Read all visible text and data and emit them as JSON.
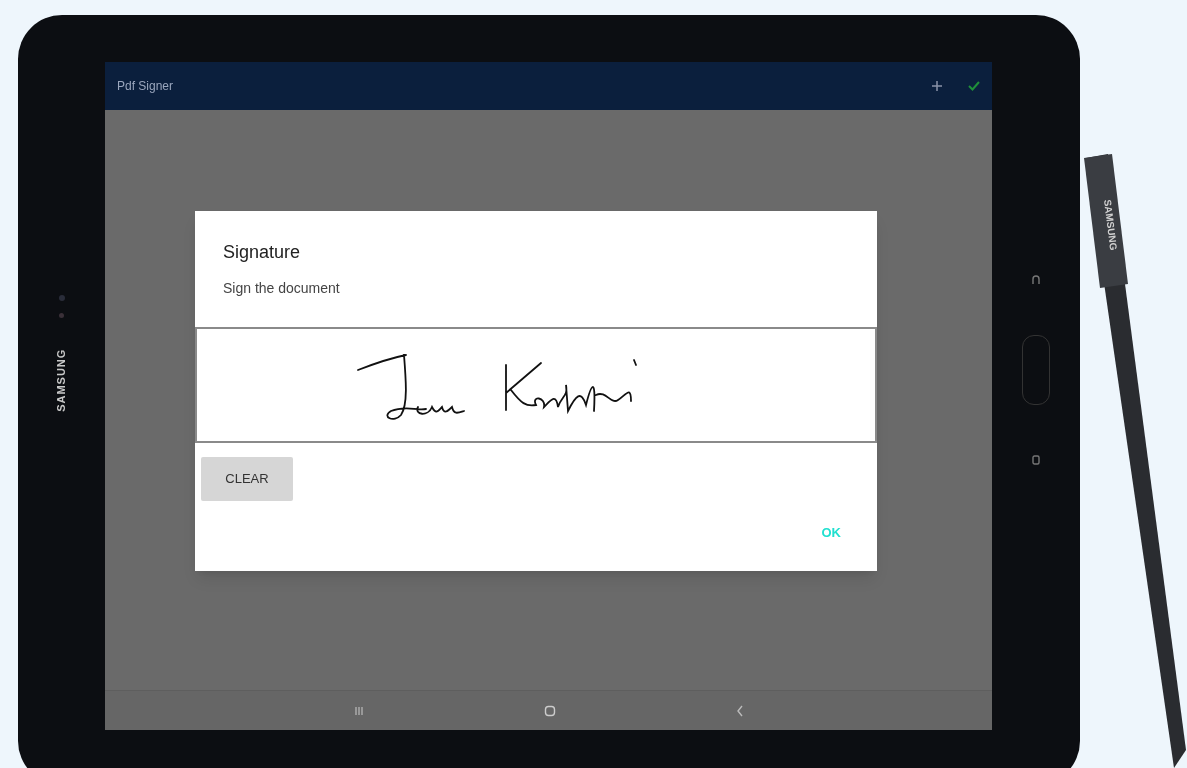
{
  "device": {
    "bezel_brand": "SAMSUNG",
    "stylus_brand": "SAMSUNG"
  },
  "app_bar": {
    "title": "Pdf Signer"
  },
  "dialog": {
    "title": "Signature",
    "subtitle": "Sign the document",
    "clear_button": "CLEAR",
    "ok_button": "OK"
  }
}
